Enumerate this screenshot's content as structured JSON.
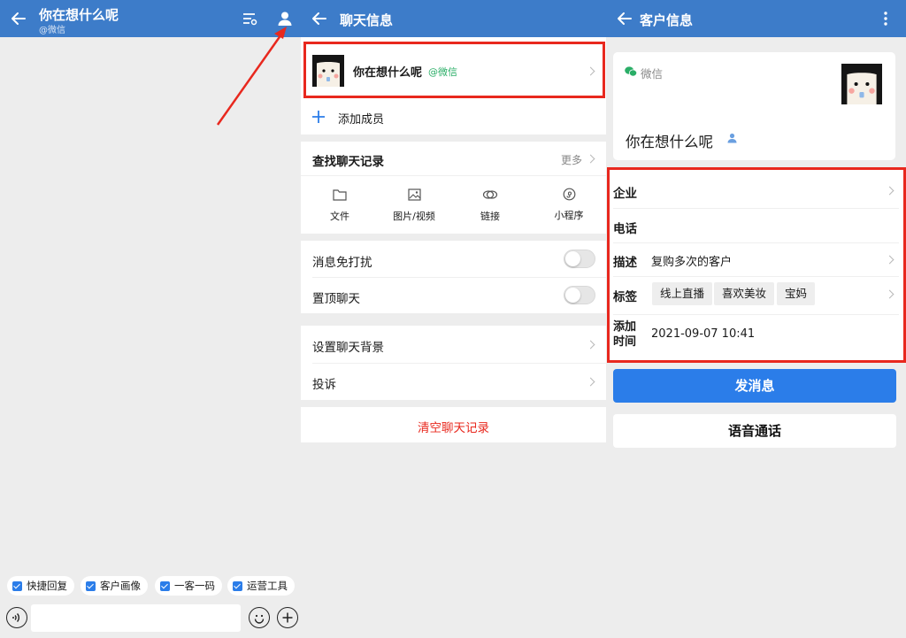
{
  "panel1": {
    "title": "你在想什么呢",
    "subtitle": "@微信",
    "quick_buttons": [
      "快捷回复",
      "客户画像",
      "一客一码",
      "运营工具"
    ]
  },
  "panel2": {
    "title": "聊天信息",
    "contact_name": "你在想什么呢",
    "contact_source": "@微信",
    "add_member": "添加成员",
    "search_history": "查找聊天记录",
    "more": "更多",
    "categories": [
      "文件",
      "图片/视频",
      "链接",
      "小程序"
    ],
    "mute": "消息免打扰",
    "pin": "置顶聊天",
    "background": "设置聊天背景",
    "complain": "投诉",
    "clear": "清空聊天记录"
  },
  "panel3": {
    "title": "客户信息",
    "source": "微信",
    "name": "你在想什么呢",
    "fields": {
      "company_label": "企业",
      "phone_label": "电话",
      "desc_label": "描述",
      "desc_value": "复购多次的客户",
      "tags_label": "标签",
      "tags": [
        "线上直播",
        "喜欢美妆",
        "宝妈"
      ],
      "time_label_1": "添加",
      "time_label_2": "时间",
      "time_value": "2021-09-07 10:41"
    },
    "send_button": "发消息",
    "voice_button": "语音通话"
  },
  "colors": {
    "header": "#3d7cc9",
    "primary_button": "#2b7de9",
    "highlight_box": "#e8281e",
    "danger_text": "#e8281e",
    "wechat_green": "#2aae67"
  }
}
